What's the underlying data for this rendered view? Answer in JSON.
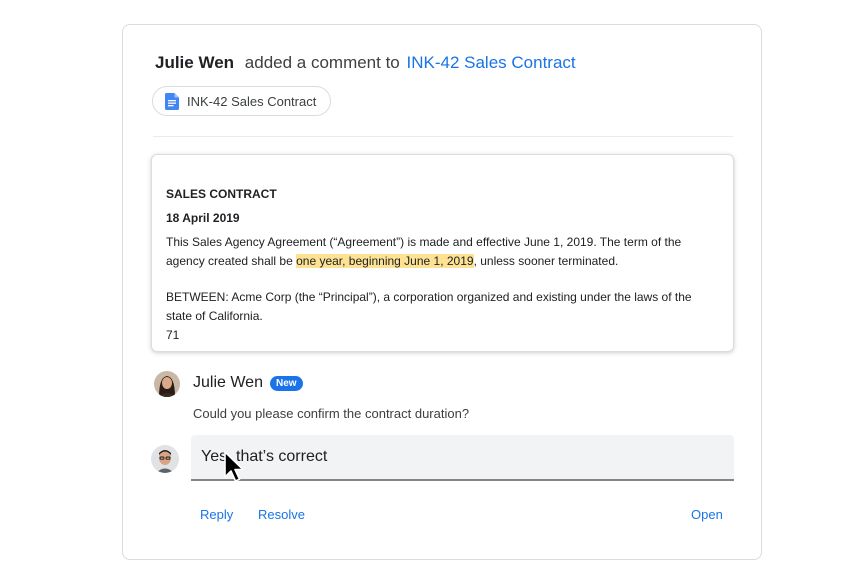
{
  "header": {
    "author": "Julie Wen",
    "verb": "added a comment to",
    "doc_link": "INK-42 Sales Contract"
  },
  "chip": {
    "label": "INK-42 Sales Contract",
    "icon": "google-docs-icon"
  },
  "document": {
    "title": "SALES CONTRACT",
    "date": "18 April 2019",
    "para1_before": "This Sales Agency Agreement (“Agreement”) is made and effective June 1, 2019. The term of the agency created shall be ",
    "para1_highlight": "one year, beginning June 1, 2019",
    "para1_after": ", unless sooner terminated.",
    "para2": "BETWEEN: Acme Corp (the “Principal”), a corporation organized and existing under the laws of the state of California.",
    "page_number": "71"
  },
  "comment": {
    "author": "Julie Wen",
    "badge": "New",
    "text": "Could you please confirm the contract duration?"
  },
  "reply": {
    "value": "Yes, that’s correct"
  },
  "actions": {
    "reply": "Reply",
    "resolve": "Resolve",
    "open": "Open"
  },
  "colors": {
    "accent": "#1a73e8",
    "highlight": "#fde293",
    "badge": "#1a73e8"
  }
}
